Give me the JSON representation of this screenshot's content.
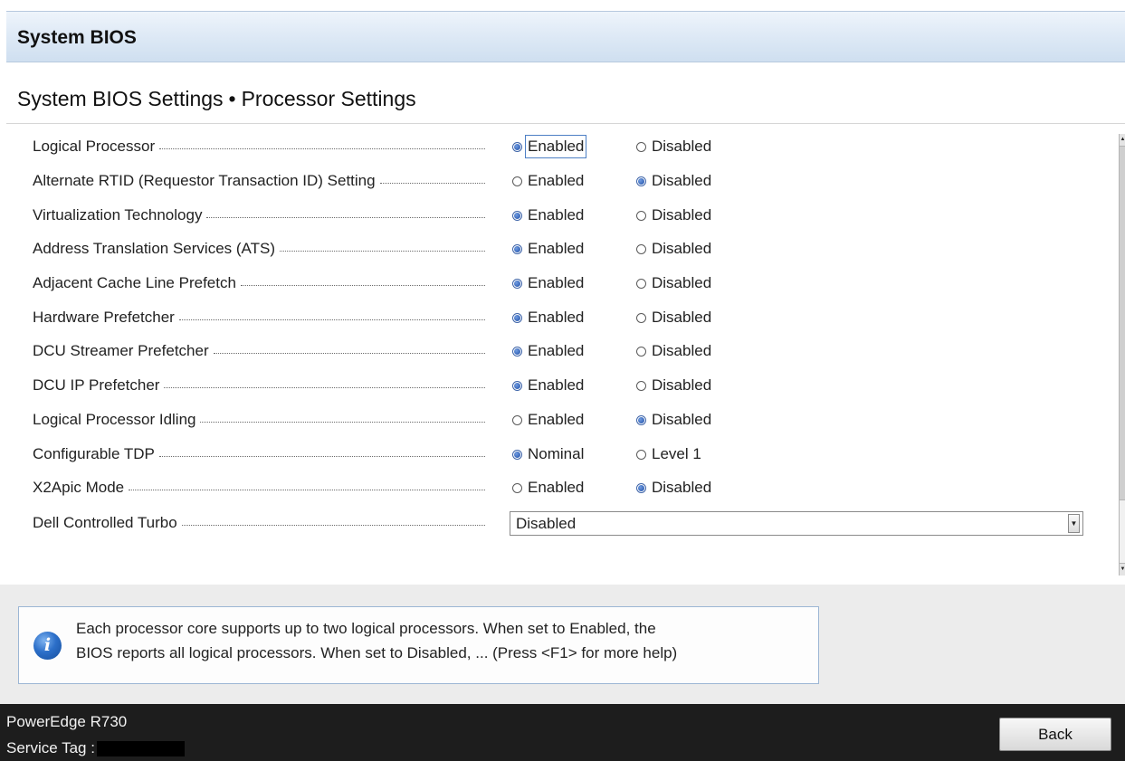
{
  "header": {
    "title": "System BIOS"
  },
  "breadcrumb": {
    "parent": "System BIOS Settings",
    "separator": "•",
    "current": "Processor Settings"
  },
  "settings": [
    {
      "label": "Logical Processor",
      "options": [
        "Enabled",
        "Disabled"
      ],
      "selected": 0,
      "focused": true
    },
    {
      "label": "Alternate RTID (Requestor Transaction ID) Setting",
      "options": [
        "Enabled",
        "Disabled"
      ],
      "selected": 1
    },
    {
      "label": "Virtualization Technology",
      "options": [
        "Enabled",
        "Disabled"
      ],
      "selected": 0
    },
    {
      "label": "Address Translation Services (ATS)",
      "options": [
        "Enabled",
        "Disabled"
      ],
      "selected": 0
    },
    {
      "label": "Adjacent Cache Line Prefetch",
      "options": [
        "Enabled",
        "Disabled"
      ],
      "selected": 0
    },
    {
      "label": "Hardware Prefetcher",
      "options": [
        "Enabled",
        "Disabled"
      ],
      "selected": 0
    },
    {
      "label": "DCU Streamer Prefetcher",
      "options": [
        "Enabled",
        "Disabled"
      ],
      "selected": 0
    },
    {
      "label": "DCU IP Prefetcher",
      "options": [
        "Enabled",
        "Disabled"
      ],
      "selected": 0
    },
    {
      "label": "Logical Processor Idling",
      "options": [
        "Enabled",
        "Disabled"
      ],
      "selected": 1
    },
    {
      "label": "Configurable TDP",
      "options": [
        "Nominal",
        "Level 1"
      ],
      "selected": 0
    },
    {
      "label": "X2Apic Mode",
      "options": [
        "Enabled",
        "Disabled"
      ],
      "selected": 1
    },
    {
      "label": "Dell Controlled Turbo",
      "dropdown": "Disabled"
    }
  ],
  "help": {
    "line1": "Each processor core supports up to two logical processors. When set to Enabled, the",
    "line2": "BIOS reports all logical processors. When set to Disabled, ... (Press <F1> for more help)",
    "icon": "info-icon"
  },
  "footer": {
    "model": "PowerEdge R730",
    "service_tag_label": "Service Tag :",
    "back_label": "Back"
  },
  "colors": {
    "header_bg": "#dce8f5",
    "footer_bg": "#1d1d1d",
    "radio_selected": "#1f4fa8",
    "help_border": "#9cb6d4"
  }
}
